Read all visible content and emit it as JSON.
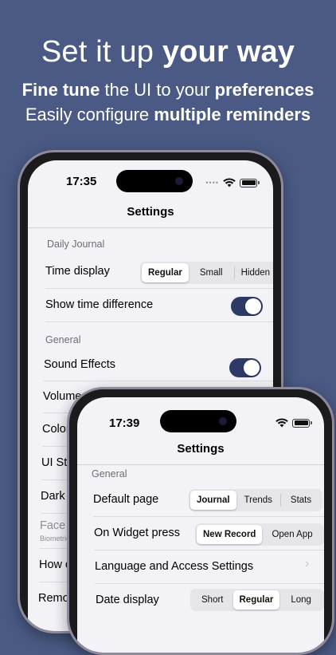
{
  "headline": {
    "prefix": "Set it up ",
    "bold": "your way"
  },
  "sub1": {
    "bold_a": "Fine tune",
    "mid": " the UI to your ",
    "bold_b": "preferences"
  },
  "sub2": {
    "prefix": "Easily configure ",
    "bold": "multiple reminders"
  },
  "back_phone": {
    "time": "17:35",
    "nav_title": "Settings",
    "section_daily": "Daily Journal",
    "time_display": {
      "label": "Time display",
      "options": [
        "Regular",
        "Small",
        "Hidden"
      ],
      "selected": "Regular"
    },
    "show_time_diff": {
      "label": "Show time difference",
      "on": true
    },
    "section_general": "General",
    "sound_effects": {
      "label": "Sound Effects",
      "on": true
    },
    "volume": "Volume",
    "color": "Color",
    "ui_style": "UI Styl",
    "dark_mode": "Dark M",
    "face_id": {
      "label": "Face ID",
      "sub": "Biometric"
    },
    "how_do": "How do",
    "remove": "Remove"
  },
  "front_phone": {
    "time": "17:39",
    "nav_title": "Settings",
    "section_general": "General",
    "default_page": {
      "label": "Default page",
      "options": [
        "Journal",
        "Trends",
        "Stats"
      ],
      "selected": "Journal"
    },
    "widget_press": {
      "label": "On Widget press",
      "options": [
        "New Record",
        "Open App"
      ],
      "selected": "New Record"
    },
    "language": "Language and Access Settings",
    "date_display": {
      "label": "Date display",
      "options": [
        "Short",
        "Regular",
        "Long"
      ],
      "selected": "Regular"
    }
  },
  "colors": {
    "background": "#4a5a84",
    "toggle_on": "#2d3a66"
  }
}
